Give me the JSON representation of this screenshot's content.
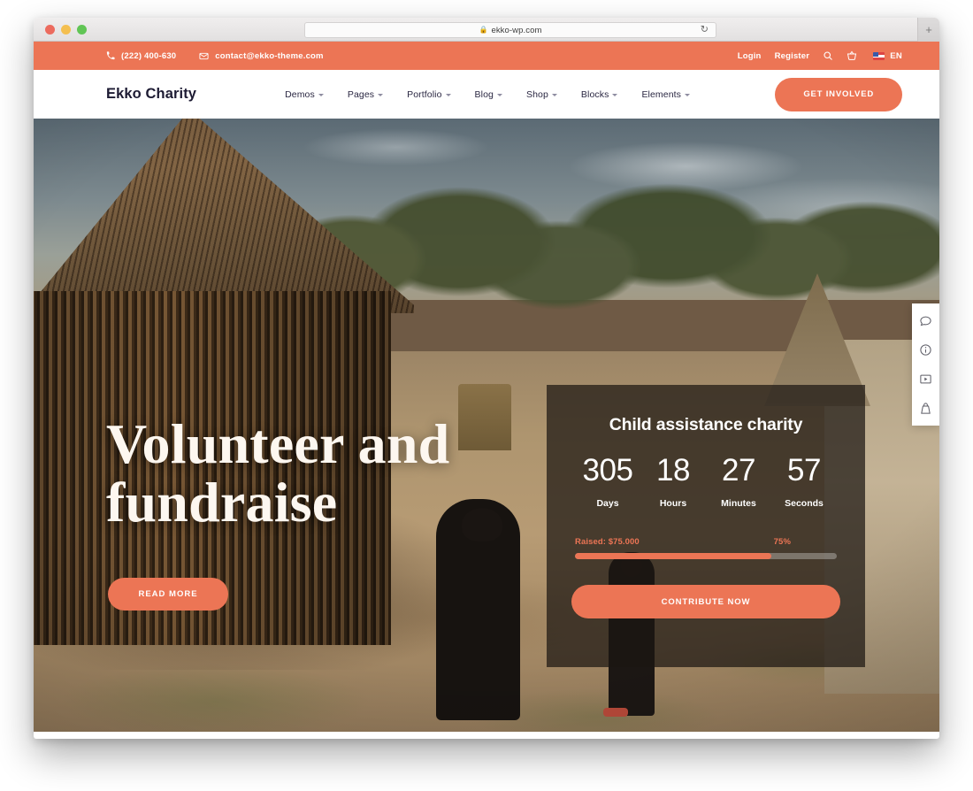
{
  "browser": {
    "url": "ekko-wp.com",
    "lock_icon": "lock-icon",
    "reload_icon": "reload-icon",
    "new_tab_label": "+"
  },
  "topbar": {
    "phone": "(222) 400-630",
    "email": "contact@ekko-theme.com",
    "phone_icon": "phone-icon",
    "email_icon": "envelope-icon",
    "login_label": "Login",
    "register_label": "Register",
    "search_icon": "search-icon",
    "cart_icon": "basket-icon",
    "flag_icon": "flag-icon",
    "language": "EN"
  },
  "nav": {
    "brand": "Ekko Charity",
    "items": [
      {
        "label": "Demos"
      },
      {
        "label": "Pages"
      },
      {
        "label": "Portfolio"
      },
      {
        "label": "Blog"
      },
      {
        "label": "Shop"
      },
      {
        "label": "Blocks"
      },
      {
        "label": "Elements"
      }
    ],
    "cta_label": "GET INVOLVED"
  },
  "hero": {
    "heading": "Volunteer and fundraise",
    "read_more_label": "READ MORE"
  },
  "countdown_card": {
    "title": "Child assistance charity",
    "units": [
      {
        "value": "305",
        "label": "Days"
      },
      {
        "value": "18",
        "label": "Hours"
      },
      {
        "value": "27",
        "label": "Minutes"
      },
      {
        "value": "57",
        "label": "Seconds"
      }
    ],
    "raised_text": "Raised: $75.000",
    "percent_text": "75%",
    "progress_percent": 75,
    "contribute_label": "CONTRIBUTE NOW"
  },
  "side_toolbar": {
    "items": [
      {
        "icon": "chat-bubble-icon"
      },
      {
        "icon": "info-circle-icon"
      },
      {
        "icon": "video-play-icon"
      },
      {
        "icon": "shopping-bag-icon"
      }
    ]
  },
  "colors": {
    "accent": "#ec7555",
    "nav_text": "#2a2742",
    "card_overlay": "rgba(28,22,18,0.72)"
  }
}
